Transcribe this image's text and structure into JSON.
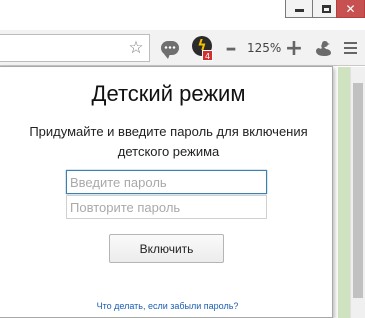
{
  "window": {
    "minimize_label": "",
    "maximize_label": "",
    "close_label": "✕"
  },
  "toolbar": {
    "zoom_out_label": "–",
    "zoom_level": "125%",
    "zoom_in_label": "+",
    "extension_badge": "4",
    "extension_letter": "ϟ"
  },
  "icons": {
    "bookmark": "star-icon",
    "chat": "chat-icon",
    "extension": "lightning-extension-icon",
    "profile": "duck-icon",
    "menu": "hamburger-menu-icon"
  },
  "popup": {
    "title": "Детский режим",
    "description_line1": "Придумайте и введите пароль для включения",
    "description_line2": "детского режима",
    "password_placeholder": "Введите пароль",
    "confirm_placeholder": "Повторите пароль",
    "enable_button": "Включить",
    "forgot_link": "Что делать, если забыли пароль?"
  },
  "colors": {
    "link": "#1a5fb4",
    "focus_border": "#3c7fb1",
    "close_button": "#c75050"
  }
}
